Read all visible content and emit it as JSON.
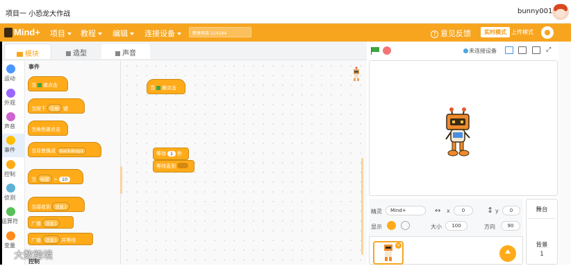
{
  "topbar": {
    "title": "项目一 小恐龙大作战",
    "user": "bunny001"
  },
  "menubar": {
    "logo_text": "Mind+",
    "items": [
      "项目",
      "教程",
      "编辑",
      "连接设备"
    ],
    "project_name": "新建项目-214184",
    "feedback": "意见反馈",
    "mode_live": "实时模式",
    "mode_upload": "上传模式"
  },
  "tabs": {
    "blocks": "模块",
    "costumes": "造型",
    "sounds": "声音"
  },
  "categories": [
    {
      "label": "运动",
      "color": "#4c97ff"
    },
    {
      "label": "外观",
      "color": "#9966ff"
    },
    {
      "label": "声音",
      "color": "#cf63cf"
    },
    {
      "label": "事件",
      "color": "#ffbf00"
    },
    {
      "label": "控制",
      "color": "#ffab19"
    },
    {
      "label": "侦测",
      "color": "#5cb1d6"
    },
    {
      "label": "运算符",
      "color": "#59c059"
    },
    {
      "label": "变量",
      "color": "#ff8c1a"
    }
  ],
  "palette": {
    "section_events": "事件",
    "section_control": "控制",
    "b1_text": "当",
    "b1_text2": "被点击",
    "b2_text": "当按下",
    "b2_dd": "空格",
    "b2_text2": "键",
    "b3_text": "当角色被点击",
    "b4_text": "当背景换成",
    "b4_dd": "backdrop1",
    "b5_text": "当",
    "b5_dd": "响度",
    "b5_op": ">",
    "b5_num": "10",
    "b6_text": "当接收到",
    "b6_dd": "消息1",
    "b7_text": "广播",
    "b7_dd": "消息1",
    "b8_text": "广播",
    "b8_dd": "消息1",
    "b8_text2": "并等待"
  },
  "workspace": {
    "hat_text": "当",
    "hat_text2": "被点击",
    "wait_text": "等待",
    "wait_num": "1",
    "wait_unit": "秒",
    "wait_until": "等待直到"
  },
  "stage_bar": {
    "connection": "未连接设备"
  },
  "sprite": {
    "label_sprite": "精灵",
    "name": "Mind+",
    "x_label": "x",
    "x": "0",
    "y_label": "y",
    "y": "0",
    "show_label": "显示",
    "size_label": "大小",
    "size": "100",
    "direction_label": "方向",
    "direction": "90"
  },
  "stage_panel": {
    "title": "舞台",
    "backdrop_label": "背景",
    "backdrop_count": "1"
  },
  "watermark": "大数跨境"
}
